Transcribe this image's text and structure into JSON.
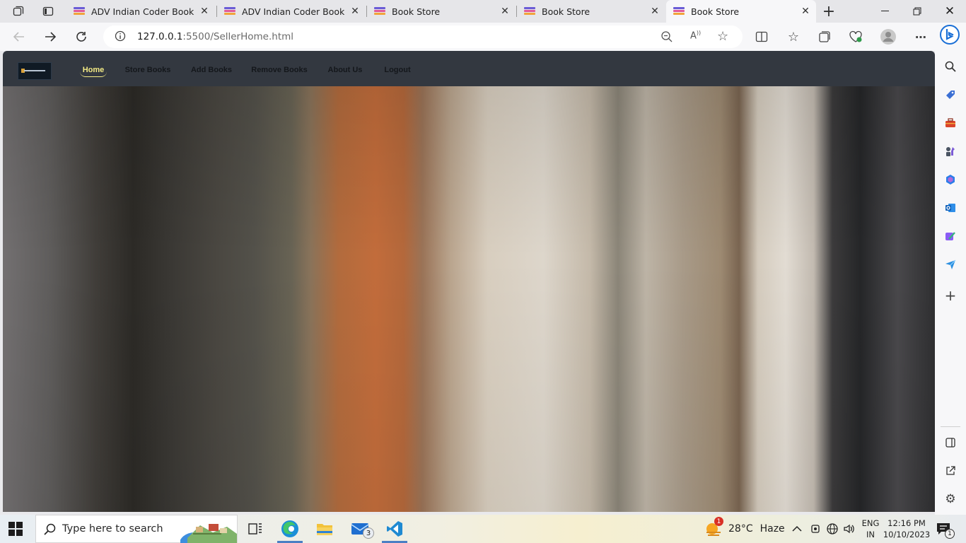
{
  "browser": {
    "tabs": [
      {
        "title": "ADV Indian Coder Book Store",
        "active": false
      },
      {
        "title": "ADV Indian Coder Book Store",
        "active": false
      },
      {
        "title": "Book Store",
        "active": false
      },
      {
        "title": "Book Store",
        "active": false
      },
      {
        "title": "Book Store",
        "active": true
      }
    ],
    "address": {
      "host": "127.0.0.1",
      "path": ":5500/SellerHome.html"
    }
  },
  "site": {
    "nav": [
      {
        "label": "Home",
        "active": true
      },
      {
        "label": "Store Books",
        "active": false
      },
      {
        "label": "Add Books",
        "active": false
      },
      {
        "label": "Remove Books",
        "active": false
      },
      {
        "label": "About Us",
        "active": false
      },
      {
        "label": "Logout",
        "active": false
      }
    ],
    "nav_active_color": "#f3ea84",
    "nav_bar_color": "#333840"
  },
  "taskbar": {
    "search_placeholder": "Type here to search",
    "mail_badge": "3",
    "weather_temp": "28°C",
    "weather_text": "Haze",
    "weather_alert": "1",
    "lang_primary": "ENG",
    "lang_secondary": "IN",
    "time": "12:16 PM",
    "date": "10/10/2023",
    "notification_count": "1"
  }
}
